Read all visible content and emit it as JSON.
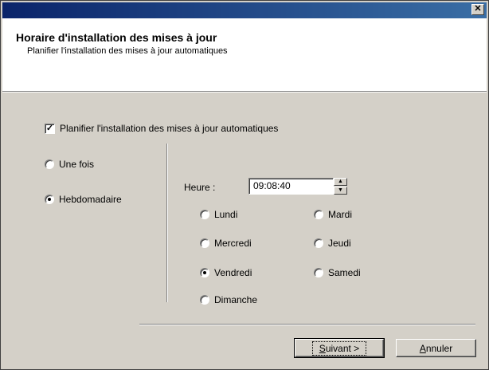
{
  "window": {
    "close_glyph": "✕"
  },
  "header": {
    "title": "Horaire d'installation des mises à jour",
    "subtitle": "Planifier l'installation des mises à jour automatiques"
  },
  "schedule_checkbox": {
    "label": "Planifier l'installation des mises à jour automatiques",
    "checked": true,
    "check_glyph": "✓"
  },
  "frequency": {
    "once_label": "Une fois",
    "weekly_label": "Hebdomadaire",
    "selected": "weekly"
  },
  "time": {
    "label": "Heure :",
    "value": "09:08:40",
    "up_glyph": "▲",
    "down_glyph": "▼"
  },
  "days": {
    "monday": "Lundi",
    "tuesday": "Mardi",
    "wednesday": "Mercredi",
    "thursday": "Jeudi",
    "friday": "Vendredi",
    "saturday": "Samedi",
    "sunday": "Dimanche",
    "selected": "friday"
  },
  "buttons": {
    "next_mnemonic": "S",
    "next_rest": "uivant >",
    "cancel_mnemonic": "A",
    "cancel_rest": "nnuler"
  }
}
